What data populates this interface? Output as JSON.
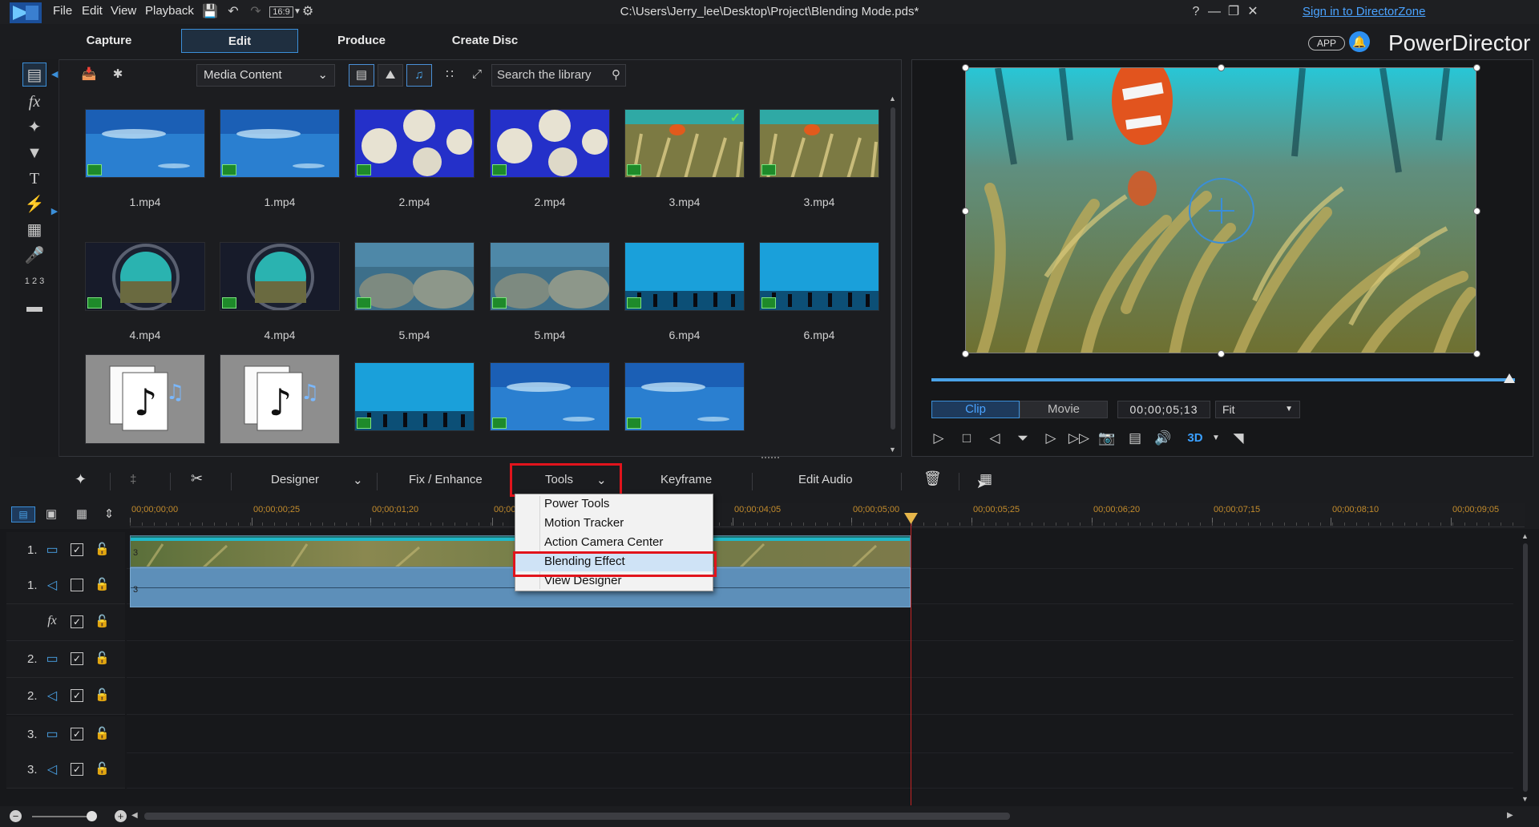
{
  "titlebar": {
    "menu": [
      "File",
      "Edit",
      "View",
      "Playback"
    ],
    "aspect": "16:9",
    "path": "C:\\Users\\Jerry_lee\\Desktop\\Project\\Blending Mode.pds*",
    "signin": "Sign in to DirectorZone",
    "help": "?"
  },
  "modes": {
    "capture": "Capture",
    "edit": "Edit",
    "produce": "Produce",
    "create_disc": "Create Disc"
  },
  "brand": {
    "app_badge": "APP",
    "name": "PowerDirector"
  },
  "library": {
    "media_select": "Media Content",
    "search_placeholder": "Search the library",
    "items": [
      {
        "label": "1.mp4",
        "style": "ocean"
      },
      {
        "label": "1.mp4",
        "style": "ocean"
      },
      {
        "label": "2.mp4",
        "style": "jelly"
      },
      {
        "label": "2.mp4",
        "style": "jelly"
      },
      {
        "label": "3.mp4",
        "style": "anemone"
      },
      {
        "label": "3.mp4",
        "style": "anemone"
      },
      {
        "label": "4.mp4",
        "style": "porthole"
      },
      {
        "label": "4.mp4",
        "style": "porthole"
      },
      {
        "label": "5.mp4",
        "style": "reef"
      },
      {
        "label": "5.mp4",
        "style": "reef"
      },
      {
        "label": "6.mp4",
        "style": "aquarium"
      },
      {
        "label": "6.mp4",
        "style": "aquarium"
      },
      {
        "label": "",
        "style": "music"
      },
      {
        "label": "",
        "style": "music"
      },
      {
        "label": "",
        "style": "aquarium"
      },
      {
        "label": "",
        "style": "ocean"
      },
      {
        "label": "",
        "style": "ocean"
      }
    ]
  },
  "preview": {
    "clip_tab": "Clip",
    "movie_tab": "Movie",
    "timecode": "00;00;05;13",
    "fit": "Fit",
    "threed": "3D"
  },
  "edit_toolbar": {
    "designer": "Designer",
    "fix_enhance": "Fix / Enhance",
    "tools": "Tools",
    "keyframe": "Keyframe",
    "edit_audio": "Edit Audio"
  },
  "tools_menu": [
    "Power Tools",
    "Motion Tracker",
    "Action Camera Center",
    "Blending Effect",
    "View Designer"
  ],
  "timeline": {
    "ticks": [
      "00;00;00;00",
      "00;00;00;25",
      "00;00;01;20",
      "00;00",
      "00;00;04;05",
      "00;00;05;00",
      "00;00;05;25",
      "00;00;06;20",
      "00;00;07;15",
      "00;00;08;10",
      "00;00;09;05"
    ],
    "tracks": [
      {
        "num": "1.",
        "type": "video",
        "checked": true
      },
      {
        "num": "1.",
        "type": "audio",
        "checked": false
      },
      {
        "num": "",
        "type": "fx",
        "checked": true
      },
      {
        "num": "2.",
        "type": "video",
        "checked": true
      },
      {
        "num": "2.",
        "type": "audio",
        "checked": true
      },
      {
        "num": "3.",
        "type": "video",
        "checked": true
      },
      {
        "num": "3.",
        "type": "audio",
        "checked": true
      }
    ]
  },
  "colors": {
    "accent": "#3b8fd9",
    "highlight": "#e1141c",
    "playhead": "#c62424"
  }
}
